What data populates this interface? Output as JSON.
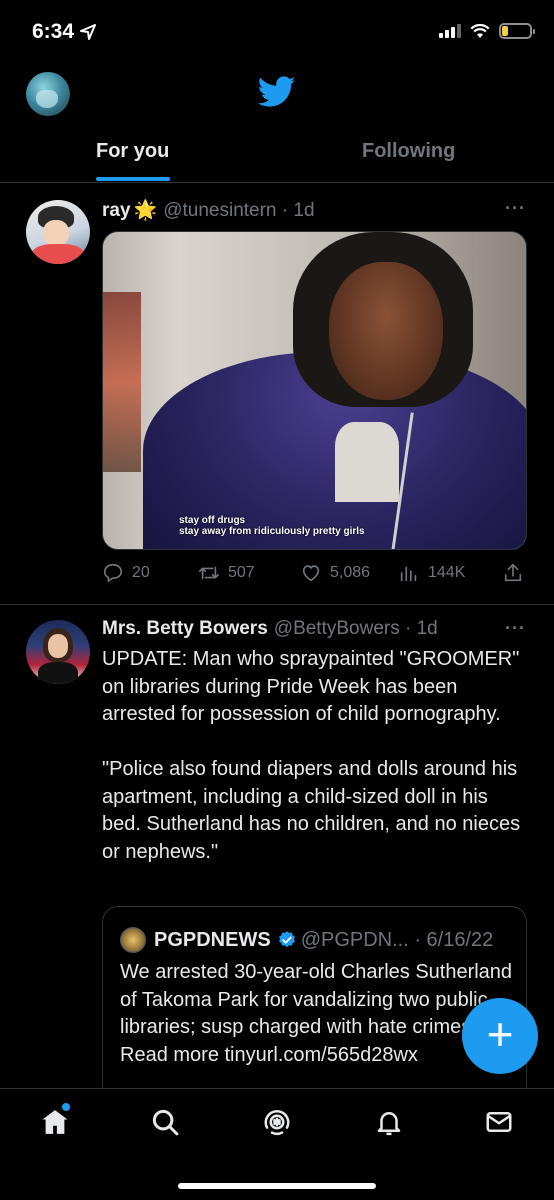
{
  "status_bar": {
    "time": "6:34",
    "battery_level": 0.2
  },
  "header": {
    "tabs": [
      {
        "label": "For you",
        "active": true
      },
      {
        "label": "Following",
        "active": false
      }
    ]
  },
  "tweets": [
    {
      "name": "ray",
      "name_emoji": "🌟",
      "handle": "@tunesintern · 1d",
      "media_caption": "stay off drugs\nstay away from ridiculously pretty girls",
      "stats": {
        "replies": "20",
        "retweets": "507",
        "likes": "5,086",
        "views": "144K"
      }
    },
    {
      "name": "Mrs. Betty Bowers",
      "handle": "@BettyBowers · 1d",
      "text": "UPDATE: Man who spraypainted \"GROOMER\" on libraries during Pride Week has been arrested for possession of child pornography.\n\n\"Police also found diapers and dolls around his apartment, including a child-sized doll in his bed. Sutherland has no children, and no nieces or nephews.\"",
      "quote": {
        "name": "PGPDNEWS",
        "handle": "@PGPDN... · 6/16/22",
        "text": "We arrested 30-year-old Charles Sutherland of Takoma Park for vandalizing two public libraries; susp charged with hate crimes. Read more tinyurl.com/565d28wx"
      }
    }
  ],
  "fab": {
    "label": "+"
  },
  "colors": {
    "accent": "#1d9bf0",
    "background": "#000000",
    "muted": "#71767b",
    "text": "#e7e9ea"
  }
}
